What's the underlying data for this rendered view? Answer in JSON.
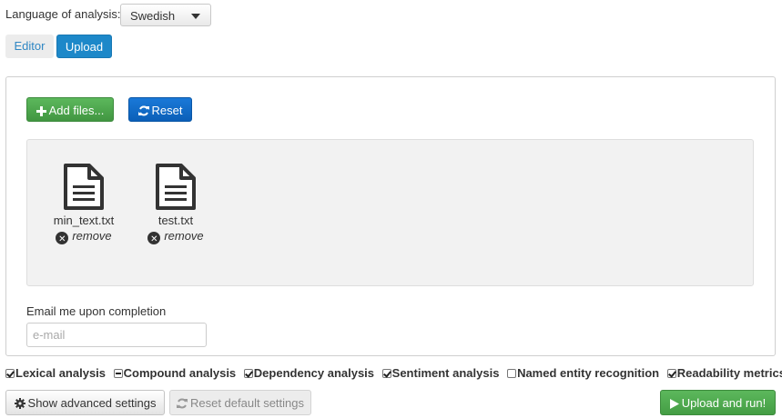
{
  "language": {
    "label": "Language of analysis:",
    "selected": "Swedish"
  },
  "tabs": [
    {
      "label": "Editor",
      "active": false
    },
    {
      "label": "Upload",
      "active": true
    }
  ],
  "upload": {
    "add_files_label": "Add files...",
    "reset_label": "Reset",
    "files": [
      {
        "name": "min_text.txt",
        "remove_label": "remove",
        "icon": "file-text-icon"
      },
      {
        "name": "test.txt",
        "remove_label": "remove",
        "icon": "file-text-icon"
      }
    ],
    "email_label": "Email me upon completion",
    "email_placeholder": "e-mail",
    "email_value": ""
  },
  "analyses": [
    {
      "label": "Lexical analysis",
      "state": "checked"
    },
    {
      "label": "Compound analysis",
      "state": "indeterminate"
    },
    {
      "label": "Dependency analysis",
      "state": "checked"
    },
    {
      "label": "Sentiment analysis",
      "state": "checked"
    },
    {
      "label": "Named entity recognition",
      "state": "unchecked"
    },
    {
      "label": "Readability metrics",
      "state": "checked"
    }
  ],
  "footer": {
    "advanced_label": "Show advanced settings",
    "reset_default_label": "Reset default settings",
    "run_label": "Upload and run!"
  },
  "colors": {
    "primary_tab": "#1d88c9",
    "success": "#5cb85c",
    "reset_button": "#0b5fb8"
  }
}
